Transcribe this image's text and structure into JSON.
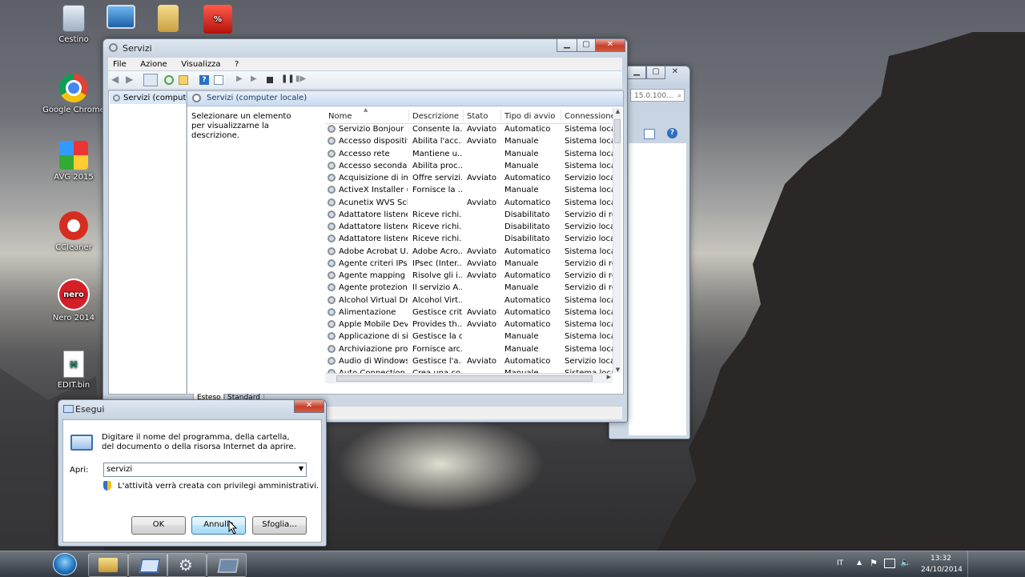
{
  "desktop_icons": [
    {
      "label": "Cestino",
      "icon": "recycle-bin-icon"
    },
    {
      "label": "",
      "icon": "computer-icon"
    },
    {
      "label": "",
      "icon": "folder-icon"
    },
    {
      "label": "",
      "icon": "promo-icon"
    },
    {
      "label": "Google Chrome",
      "icon": "chrome-icon"
    },
    {
      "label": "AVG 2015",
      "icon": "avg-icon"
    },
    {
      "label": "CCleaner",
      "icon": "ccleaner-icon"
    },
    {
      "label": "Nero 2014",
      "icon": "nero-icon"
    },
    {
      "label": "EDIT.bin",
      "icon": "file-icon"
    }
  ],
  "back_window": {
    "search_text": "15.0.100..."
  },
  "services_window": {
    "title": "Servizi",
    "menu": [
      "File",
      "Azione",
      "Visualizza",
      "?"
    ],
    "tree_item": "Servizi (computer",
    "header_title": "Servizi (computer locale)",
    "description_hint": "Selezionare un elemento per visualizzarne la descrizione.",
    "columns": [
      "Nome",
      "Descrizione",
      "Stato",
      "Tipo di avvio",
      "Connessione"
    ],
    "rows": [
      {
        "name": "Servizio Bonjour",
        "desc": "Consente la...",
        "state": "Avviato",
        "startup": "Automatico",
        "logon": "Sistema locale"
      },
      {
        "name": "Accesso dispositiv...",
        "desc": "Abilita l'acc...",
        "state": "Avviato",
        "startup": "Manuale",
        "logon": "Sistema locale"
      },
      {
        "name": "Accesso rete",
        "desc": "Mantiene u...",
        "state": "",
        "startup": "Manuale",
        "logon": "Sistema locale"
      },
      {
        "name": "Accesso secondario",
        "desc": "Abilita proc...",
        "state": "",
        "startup": "Manuale",
        "logon": "Sistema locale"
      },
      {
        "name": "Acquisizione di im...",
        "desc": "Offre servizi...",
        "state": "Avviato",
        "startup": "Automatico",
        "logon": "Servizio locale"
      },
      {
        "name": "ActiveX Installer (...",
        "desc": "Fornisce la ...",
        "state": "",
        "startup": "Manuale",
        "logon": "Sistema locale"
      },
      {
        "name": "Acunetix WVS Sch...",
        "desc": "",
        "state": "Avviato",
        "startup": "Automatico",
        "logon": "Sistema locale"
      },
      {
        "name": "Adattatore listener...",
        "desc": "Riceve richi...",
        "state": "",
        "startup": "Disabilitato",
        "logon": "Servizio di rete"
      },
      {
        "name": "Adattatore listener...",
        "desc": "Riceve richi...",
        "state": "",
        "startup": "Disabilitato",
        "logon": "Servizio locale"
      },
      {
        "name": "Adattatore listener...",
        "desc": "Riceve richi...",
        "state": "",
        "startup": "Disabilitato",
        "logon": "Servizio locale"
      },
      {
        "name": "Adobe Acrobat U...",
        "desc": "Adobe Acro...",
        "state": "Avviato",
        "startup": "Automatico",
        "logon": "Sistema locale"
      },
      {
        "name": "Agente criteri IPsec",
        "desc": "IPsec (Inter...",
        "state": "Avviato",
        "startup": "Manuale",
        "logon": "Servizio di rete"
      },
      {
        "name": "Agente mapping ...",
        "desc": "Risolve gli i...",
        "state": "Avviato",
        "startup": "Automatico",
        "logon": "Servizio di rete"
      },
      {
        "name": "Agente protezione...",
        "desc": "Il servizio A...",
        "state": "",
        "startup": "Manuale",
        "logon": "Servizio di rete"
      },
      {
        "name": "Alcohol Virtual Dri...",
        "desc": "Alcohol Virt...",
        "state": "",
        "startup": "Automatico",
        "logon": "Sistema locale"
      },
      {
        "name": "Alimentazione",
        "desc": "Gestisce crit...",
        "state": "Avviato",
        "startup": "Automatico",
        "logon": "Sistema locale"
      },
      {
        "name": "Apple Mobile Devi...",
        "desc": "Provides th...",
        "state": "Avviato",
        "startup": "Automatico",
        "logon": "Sistema locale"
      },
      {
        "name": "Applicazione di sis...",
        "desc": "Gestisce la c...",
        "state": "",
        "startup": "Manuale",
        "logon": "Sistema locale"
      },
      {
        "name": "Archiviazione prot...",
        "desc": "Fornisce arc...",
        "state": "",
        "startup": "Manuale",
        "logon": "Sistema locale"
      },
      {
        "name": "Audio di Windows",
        "desc": "Gestisce l'a...",
        "state": "Avviato",
        "startup": "Automatico",
        "logon": "Servizio locale"
      },
      {
        "name": "Auto Connection ...",
        "desc": "Crea una co...",
        "state": "",
        "startup": "Manuale",
        "logon": "Sistema locale"
      }
    ],
    "tabs": [
      "Esteso",
      "Standard"
    ]
  },
  "run_dialog": {
    "title": "Esegui",
    "prompt": "Digitare il nome del programma, della cartella, del documento o della risorsa Internet da aprire.",
    "open_label": "Apri:",
    "open_value": "servizi",
    "admin_note": "L'attività verrà creata con privilegi amministrativi.",
    "ok": "OK",
    "cancel": "Annulla",
    "browse": "Sfoglia..."
  },
  "taskbar": {
    "lang": "IT",
    "time": "13:32",
    "date": "24/10/2014",
    "items": [
      "start-orb-icon",
      "explorer-icon",
      "run-icon",
      "services-icon",
      "window-icon"
    ]
  },
  "colors": {
    "close_red": "#c7402c",
    "accent_blue": "#3c7fb1"
  }
}
